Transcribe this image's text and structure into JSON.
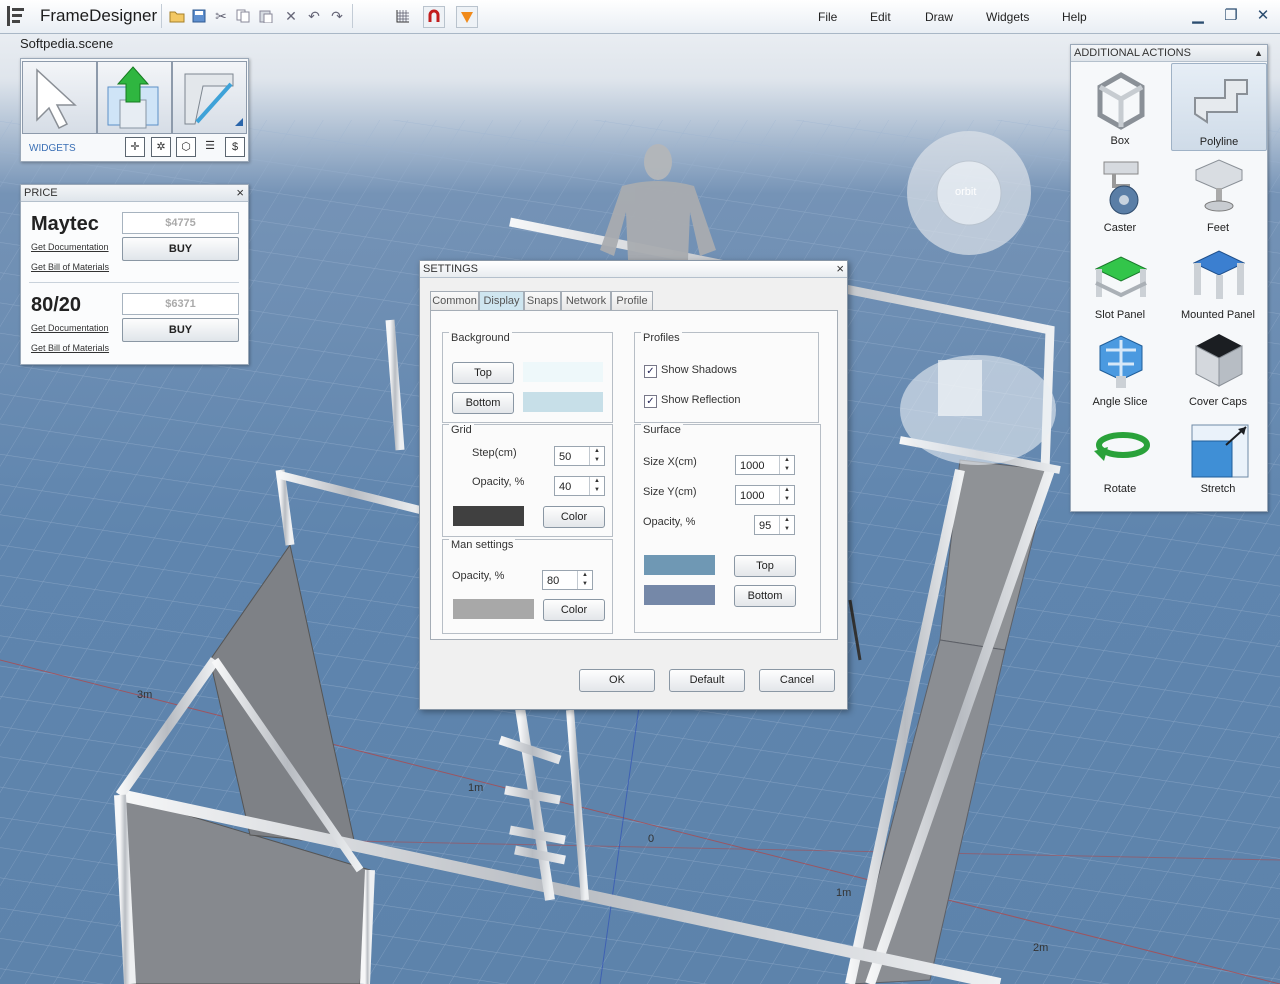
{
  "app": {
    "title": "FrameDesigner",
    "scene_name": "Softpedia.scene"
  },
  "menu": [
    "File",
    "Edit",
    "Draw",
    "Widgets",
    "Help"
  ],
  "widgets_panel": {
    "label": "WIDGETS"
  },
  "price_panel": {
    "title": "PRICE",
    "close": "×",
    "vendors": [
      {
        "name": "Maytec",
        "price": "$4775",
        "buy": "BUY",
        "doc_link": "Get Documentation",
        "bom_link": "Get Bill of Materials"
      },
      {
        "name": "80/20",
        "price": "$6371",
        "buy": "BUY",
        "doc_link": "Get Documentation",
        "bom_link": "Get Bill of Materials"
      }
    ]
  },
  "settings": {
    "title": "SETTINGS",
    "close": "×",
    "tabs": [
      "Common",
      "Display",
      "Snaps",
      "Network",
      "Profile"
    ],
    "active_tab": "Display",
    "background": {
      "title": "Background",
      "top_label": "Top",
      "bottom_label": "Bottom",
      "top_color": "#eef8fa",
      "bottom_color": "#c7dfe8"
    },
    "grid": {
      "title": "Grid",
      "step_label": "Step(cm)",
      "step_value": "50",
      "opacity_label": "Opacity, %",
      "opacity_value": "40",
      "color_label": "Color",
      "color": "#404040"
    },
    "man": {
      "title": "Man settings",
      "opacity_label": "Opacity, %",
      "opacity_value": "80",
      "color_label": "Color",
      "color": "#a8a8a8"
    },
    "profiles": {
      "title": "Profiles",
      "show_shadows": "Show Shadows",
      "show_reflection": "Show Reflection"
    },
    "surface": {
      "title": "Surface",
      "size_x_label": "Size X(cm)",
      "size_x_value": "1000",
      "size_y_label": "Size Y(cm)",
      "size_y_value": "1000",
      "opacity_label": "Opacity, %",
      "opacity_value": "95",
      "top_label": "Top",
      "bottom_label": "Bottom",
      "top_color": "#6f98b4",
      "bottom_color": "#7588a8"
    },
    "buttons": {
      "ok": "OK",
      "default": "Default",
      "cancel": "Cancel"
    }
  },
  "additional_actions": {
    "title": "ADDITIONAL ACTIONS",
    "items": [
      "Box",
      "Polyline",
      "Caster",
      "Feet",
      "Slot Panel",
      "Mounted Panel",
      "Angle Slice",
      "Cover Caps",
      "Rotate",
      "Stretch"
    ],
    "selected": "Polyline"
  },
  "scene_labels": {
    "m3": "3m",
    "m1_left": "1m",
    "origin": "0",
    "m1_right": "1m",
    "m2": "2m",
    "orbit": "orbit"
  }
}
